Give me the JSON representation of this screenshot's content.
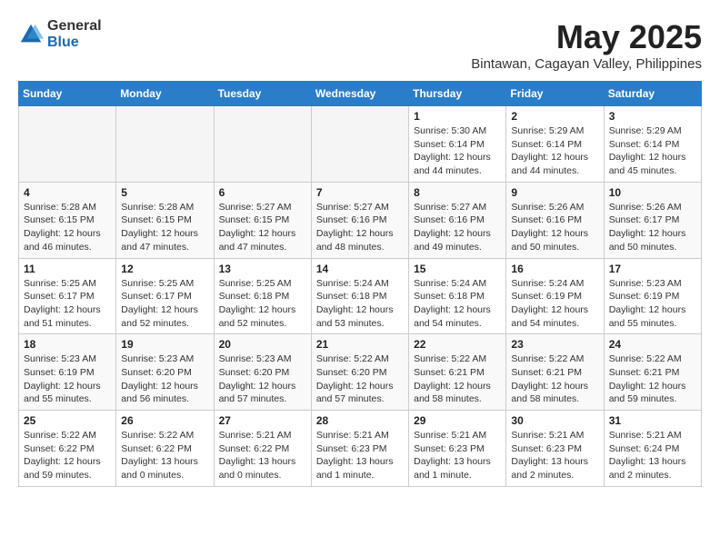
{
  "logo": {
    "general": "General",
    "blue": "Blue"
  },
  "title": "May 2025",
  "subtitle": "Bintawan, Cagayan Valley, Philippines",
  "headers": [
    "Sunday",
    "Monday",
    "Tuesday",
    "Wednesday",
    "Thursday",
    "Friday",
    "Saturday"
  ],
  "weeks": [
    [
      {
        "day": "",
        "empty": true
      },
      {
        "day": "",
        "empty": true
      },
      {
        "day": "",
        "empty": true
      },
      {
        "day": "",
        "empty": true
      },
      {
        "day": "1",
        "sunrise": "5:30 AM",
        "sunset": "6:14 PM",
        "daylight": "12 hours and 44 minutes."
      },
      {
        "day": "2",
        "sunrise": "5:29 AM",
        "sunset": "6:14 PM",
        "daylight": "12 hours and 44 minutes."
      },
      {
        "day": "3",
        "sunrise": "5:29 AM",
        "sunset": "6:14 PM",
        "daylight": "12 hours and 45 minutes."
      }
    ],
    [
      {
        "day": "4",
        "sunrise": "5:28 AM",
        "sunset": "6:15 PM",
        "daylight": "12 hours and 46 minutes."
      },
      {
        "day": "5",
        "sunrise": "5:28 AM",
        "sunset": "6:15 PM",
        "daylight": "12 hours and 47 minutes."
      },
      {
        "day": "6",
        "sunrise": "5:27 AM",
        "sunset": "6:15 PM",
        "daylight": "12 hours and 47 minutes."
      },
      {
        "day": "7",
        "sunrise": "5:27 AM",
        "sunset": "6:16 PM",
        "daylight": "12 hours and 48 minutes."
      },
      {
        "day": "8",
        "sunrise": "5:27 AM",
        "sunset": "6:16 PM",
        "daylight": "12 hours and 49 minutes."
      },
      {
        "day": "9",
        "sunrise": "5:26 AM",
        "sunset": "6:16 PM",
        "daylight": "12 hours and 50 minutes."
      },
      {
        "day": "10",
        "sunrise": "5:26 AM",
        "sunset": "6:17 PM",
        "daylight": "12 hours and 50 minutes."
      }
    ],
    [
      {
        "day": "11",
        "sunrise": "5:25 AM",
        "sunset": "6:17 PM",
        "daylight": "12 hours and 51 minutes."
      },
      {
        "day": "12",
        "sunrise": "5:25 AM",
        "sunset": "6:17 PM",
        "daylight": "12 hours and 52 minutes."
      },
      {
        "day": "13",
        "sunrise": "5:25 AM",
        "sunset": "6:18 PM",
        "daylight": "12 hours and 52 minutes."
      },
      {
        "day": "14",
        "sunrise": "5:24 AM",
        "sunset": "6:18 PM",
        "daylight": "12 hours and 53 minutes."
      },
      {
        "day": "15",
        "sunrise": "5:24 AM",
        "sunset": "6:18 PM",
        "daylight": "12 hours and 54 minutes."
      },
      {
        "day": "16",
        "sunrise": "5:24 AM",
        "sunset": "6:19 PM",
        "daylight": "12 hours and 54 minutes."
      },
      {
        "day": "17",
        "sunrise": "5:23 AM",
        "sunset": "6:19 PM",
        "daylight": "12 hours and 55 minutes."
      }
    ],
    [
      {
        "day": "18",
        "sunrise": "5:23 AM",
        "sunset": "6:19 PM",
        "daylight": "12 hours and 55 minutes."
      },
      {
        "day": "19",
        "sunrise": "5:23 AM",
        "sunset": "6:20 PM",
        "daylight": "12 hours and 56 minutes."
      },
      {
        "day": "20",
        "sunrise": "5:23 AM",
        "sunset": "6:20 PM",
        "daylight": "12 hours and 57 minutes."
      },
      {
        "day": "21",
        "sunrise": "5:22 AM",
        "sunset": "6:20 PM",
        "daylight": "12 hours and 57 minutes."
      },
      {
        "day": "22",
        "sunrise": "5:22 AM",
        "sunset": "6:21 PM",
        "daylight": "12 hours and 58 minutes."
      },
      {
        "day": "23",
        "sunrise": "5:22 AM",
        "sunset": "6:21 PM",
        "daylight": "12 hours and 58 minutes."
      },
      {
        "day": "24",
        "sunrise": "5:22 AM",
        "sunset": "6:21 PM",
        "daylight": "12 hours and 59 minutes."
      }
    ],
    [
      {
        "day": "25",
        "sunrise": "5:22 AM",
        "sunset": "6:22 PM",
        "daylight": "12 hours and 59 minutes."
      },
      {
        "day": "26",
        "sunrise": "5:22 AM",
        "sunset": "6:22 PM",
        "daylight": "13 hours and 0 minutes."
      },
      {
        "day": "27",
        "sunrise": "5:21 AM",
        "sunset": "6:22 PM",
        "daylight": "13 hours and 0 minutes."
      },
      {
        "day": "28",
        "sunrise": "5:21 AM",
        "sunset": "6:23 PM",
        "daylight": "13 hours and 1 minute."
      },
      {
        "day": "29",
        "sunrise": "5:21 AM",
        "sunset": "6:23 PM",
        "daylight": "13 hours and 1 minute."
      },
      {
        "day": "30",
        "sunrise": "5:21 AM",
        "sunset": "6:23 PM",
        "daylight": "13 hours and 2 minutes."
      },
      {
        "day": "31",
        "sunrise": "5:21 AM",
        "sunset": "6:24 PM",
        "daylight": "13 hours and 2 minutes."
      }
    ]
  ]
}
